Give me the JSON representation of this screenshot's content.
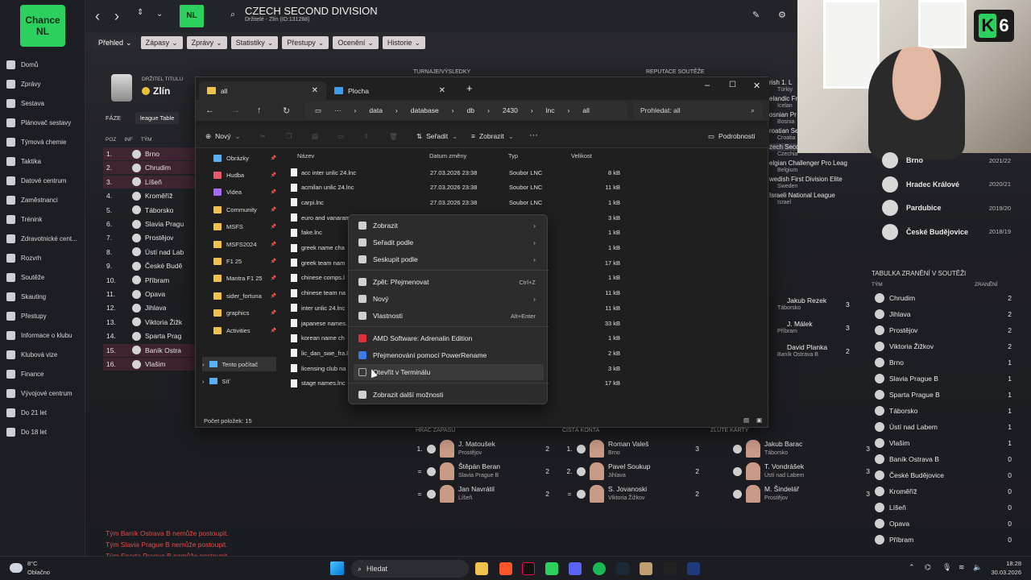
{
  "fm": {
    "logo": "Chance NL",
    "title": "CZECH SECOND DIVISION",
    "subtitle": "Držitelé - Zlín (ID:131288)",
    "menu": [
      "Přehled",
      "Zápasy",
      "Zprávy",
      "Statistiky",
      "Přestupy",
      "Ocenění",
      "Historie"
    ],
    "sidebar": [
      "Domů",
      "Zprávy",
      "Sestava",
      "Plánovač sestavy",
      "Týmová chemie",
      "Taktika",
      "Datové centrum",
      "Zaměstnanci",
      "Trénink",
      "Zdravotnické cent...",
      "Rozvrh",
      "Soutěže",
      "Skauting",
      "Přestupy",
      "Informace o klubu",
      "Klubová vize",
      "Finance",
      "Vývojové centrum",
      "Do 21 let",
      "Do 18 let"
    ],
    "holder_label": "DRŽITEL TITULU",
    "holder": "Zlín",
    "tournament_header": "TURNAJE/VÝSLEDKY",
    "reputation_header": "REPUTACE SOUTĚŽE",
    "phase_label": "FÁZE",
    "phase_value": "league Table",
    "table_headers": [
      "POZ",
      "INF",
      "TÝM"
    ],
    "table": [
      {
        "pos": "1.",
        "team": "Brno"
      },
      {
        "pos": "2.",
        "team": "Chrudim"
      },
      {
        "pos": "3.",
        "team": "Líšeň"
      },
      {
        "pos": "4.",
        "team": "Kroměříž"
      },
      {
        "pos": "5.",
        "team": "Táborsko"
      },
      {
        "pos": "6.",
        "team": "Slavia Pragu"
      },
      {
        "pos": "7.",
        "team": "Prostějov"
      },
      {
        "pos": "8.",
        "team": "Ústí nad Lab"
      },
      {
        "pos": "9.",
        "team": "České Budě"
      },
      {
        "pos": "10.",
        "team": "Příbram"
      },
      {
        "pos": "11.",
        "team": "Opava"
      },
      {
        "pos": "12.",
        "team": "Jihlava"
      },
      {
        "pos": "13.",
        "team": "Viktoria Žižk"
      },
      {
        "pos": "14.",
        "team": "Sparta Prag"
      },
      {
        "pos": "15.",
        "team": "Baník Ostra"
      },
      {
        "pos": "16.",
        "team": "Vlašim"
      }
    ],
    "reputation": [
      {
        "name": "rish 1. L",
        "country": "Türkiy"
      },
      {
        "name": "elandic Fr",
        "country": "Icelan"
      },
      {
        "name": "osnian Pr",
        "country": "Bosnia"
      },
      {
        "name": "roatian Second",
        "country": "Croatia"
      },
      {
        "name": "zech Second Division",
        "country": "Czechia"
      },
      {
        "name": "elgian Challenger Pro Leag",
        "country": "Belgium"
      },
      {
        "name": "wedish First Division Elite",
        "country": "Sweden"
      },
      {
        "name": "Israeli National League",
        "country": "Israel"
      }
    ],
    "history": [
      {
        "team": "Brno",
        "season": "2021/22"
      },
      {
        "team": "Hradec Králové",
        "season": "2020/21"
      },
      {
        "team": "Pardubice",
        "season": "2019/20"
      },
      {
        "team": "České Budějovice",
        "season": "2018/19"
      }
    ],
    "injury_title": "TABULKA ZRANĚNÍ V SOUTĚŽI",
    "injury_col_team": "TÝM",
    "injury_col_count": "ZRANĚNÍ",
    "injuries": [
      {
        "team": "Chrudim",
        "n": "2"
      },
      {
        "team": "Jihlava",
        "n": "2"
      },
      {
        "team": "Prostějov",
        "n": "2"
      },
      {
        "team": "Viktoria Žižkov",
        "n": "2"
      },
      {
        "team": "Brno",
        "n": "1"
      },
      {
        "team": "Slavia Prague B",
        "n": "1"
      },
      {
        "team": "Sparta Prague B",
        "n": "1"
      },
      {
        "team": "Táborsko",
        "n": "1"
      },
      {
        "team": "Ústí nad Labem",
        "n": "1"
      },
      {
        "team": "Vlašim",
        "n": "1"
      },
      {
        "team": "Baník Ostrava B",
        "n": "0"
      },
      {
        "team": "České Budějovice",
        "n": "0"
      },
      {
        "team": "Kroměříž",
        "n": "0"
      },
      {
        "team": "Líšeň",
        "n": "0"
      },
      {
        "team": "Opava",
        "n": "0"
      },
      {
        "team": "Příbram",
        "n": "0"
      }
    ],
    "scorers": [
      {
        "name": "Jakub Rezek",
        "club": "Táborsko",
        "n": "3"
      },
      {
        "name": "J. Málek",
        "club": "Příbram",
        "n": "3"
      },
      {
        "name": "David Planka",
        "club": "Baník Ostrava B",
        "n": "2"
      }
    ],
    "stats_headers": [
      "HRÁČ ZÁPASU",
      "ČISTÁ KONTA",
      "ŽLUTÉ KARTY"
    ],
    "motm": [
      {
        "rank": "1.",
        "name": "J. Matoušek",
        "club": "Prostějov",
        "n": "2"
      },
      {
        "rank": "=",
        "name": "Štěpán Beran",
        "club": "Slavia Prague B",
        "n": "2"
      },
      {
        "rank": "=",
        "name": "Jan Navrátil",
        "club": "Líšeň",
        "n": "2"
      }
    ],
    "clean": [
      {
        "rank": "1.",
        "name": "Roman Valeš",
        "club": "Brno",
        "n": "3"
      },
      {
        "rank": "2.",
        "name": "Pavel Soukup",
        "club": "Jihlava",
        "n": "2"
      },
      {
        "rank": "=",
        "name": "S. Jovanoski",
        "club": "Viktoria Žižkov",
        "n": "2"
      }
    ],
    "yellow": [
      {
        "name": "Jakub Barac",
        "club": "Táborsko",
        "n": "3"
      },
      {
        "name": "T. Vondrášek",
        "club": "Ústí nad Labem",
        "n": "3"
      },
      {
        "name": "M. Šindelář",
        "club": "Prostějov",
        "n": "3"
      }
    ],
    "messages": [
      "Tým Baník Ostrava B nemůže postoupit.",
      "Tým Slavia Prague B nemůže postoupit.",
      "Tým Sparta Prague B nemůže postoupit."
    ]
  },
  "explorer": {
    "tabs": [
      "all",
      "Plocha"
    ],
    "breadcrumb": [
      "data",
      "database",
      "db",
      "2430",
      "lnc",
      "all"
    ],
    "search_placeholder": "Prohledat: all",
    "cmd": {
      "new": "Nový",
      "sort": "Seřadit",
      "view": "Zobrazit",
      "details": "Podrobnosti"
    },
    "nav": [
      {
        "label": "Obrázky",
        "icon": "pictures-icon"
      },
      {
        "label": "Hudba",
        "icon": "music-icon"
      },
      {
        "label": "Videa",
        "icon": "videos-icon"
      },
      {
        "label": "Community",
        "icon": "folder-icon"
      },
      {
        "label": "MSFS",
        "icon": "folder-icon"
      },
      {
        "label": "MSFS2024",
        "icon": "folder-icon"
      },
      {
        "label": "F1 25",
        "icon": "folder-icon"
      },
      {
        "label": "Mantra F1 25",
        "icon": "folder-icon"
      },
      {
        "label": "sider_fortuna",
        "icon": "folder-icon"
      },
      {
        "label": "graphics",
        "icon": "folder-icon"
      },
      {
        "label": "Activities",
        "icon": "folder-icon"
      }
    ],
    "nav_bottom": [
      "Tento počítač",
      "Síť"
    ],
    "columns": [
      "Název",
      "Datum změny",
      "Typ",
      "Velikost"
    ],
    "files": [
      {
        "name": "acc inter unlic 24.lnc",
        "date": "27.03.2026 23:38",
        "type": "Soubor LNC",
        "size": "8 kB"
      },
      {
        "name": "acmilan unlic 24.lnc",
        "date": "27.03.2026 23:38",
        "type": "Soubor LNC",
        "size": "11 kB"
      },
      {
        "name": "carpi.lnc",
        "date": "27.03.2026 23:38",
        "type": "Soubor LNC",
        "size": "1 kB"
      },
      {
        "name": "euro and vanarama",
        "date": "",
        "type": "",
        "size": "3 kB"
      },
      {
        "name": "fake.lnc",
        "date": "",
        "type": "",
        "size": "1 kB"
      },
      {
        "name": "greek name cha",
        "date": "",
        "type": "",
        "size": "1 kB"
      },
      {
        "name": "greek team nam",
        "date": "",
        "type": "",
        "size": "17 kB"
      },
      {
        "name": "chinese comps.l",
        "date": "",
        "type": "",
        "size": "1 kB"
      },
      {
        "name": "chinese team na",
        "date": "",
        "type": "",
        "size": "11 kB"
      },
      {
        "name": "inter unlic 24.lnc",
        "date": "",
        "type": "",
        "size": "11 kB"
      },
      {
        "name": "japanese names.",
        "date": "",
        "type": "",
        "size": "33 kB"
      },
      {
        "name": "korean name ch",
        "date": "",
        "type": "",
        "size": "1 kB"
      },
      {
        "name": "lic_dan_swe_fra.l",
        "date": "",
        "type": "",
        "size": "2 kB"
      },
      {
        "name": "licensing club na",
        "date": "",
        "type": "",
        "size": "3 kB"
      },
      {
        "name": "stage names.lnc",
        "date": "",
        "type": "",
        "size": "17 kB"
      }
    ],
    "status": "Počet položek: 15"
  },
  "context_menu": [
    {
      "label": "Zobrazit",
      "shortcut": "",
      "arrow": "›"
    },
    {
      "label": "Seřadit podle",
      "shortcut": "",
      "arrow": "›"
    },
    {
      "label": "Seskupit podle",
      "shortcut": "",
      "arrow": "›"
    },
    {
      "label": "Zpět: Přejmenovat",
      "shortcut": "Ctrl+Z",
      "arrow": ""
    },
    {
      "label": "Nový",
      "shortcut": "",
      "arrow": "›"
    },
    {
      "label": "Vlastnosti",
      "shortcut": "Alt+Enter",
      "arrow": ""
    },
    {
      "label": "AMD Software: Adrenalin Edition",
      "shortcut": "",
      "arrow": ""
    },
    {
      "label": "Přejmenování pomocí PowerRename",
      "shortcut": "",
      "arrow": ""
    },
    {
      "label": "Otevřít v Terminálu",
      "shortcut": "",
      "arrow": ""
    },
    {
      "label": "Zobrazit další možnosti",
      "shortcut": "",
      "arrow": ""
    }
  ],
  "taskbar": {
    "weather_temp": "8°C",
    "weather_text": "Oblačno",
    "search": "Hledat",
    "time": "18:28",
    "date": "30.03.2026"
  },
  "webcam": {
    "badge_letter": "K",
    "badge_num": "6"
  }
}
